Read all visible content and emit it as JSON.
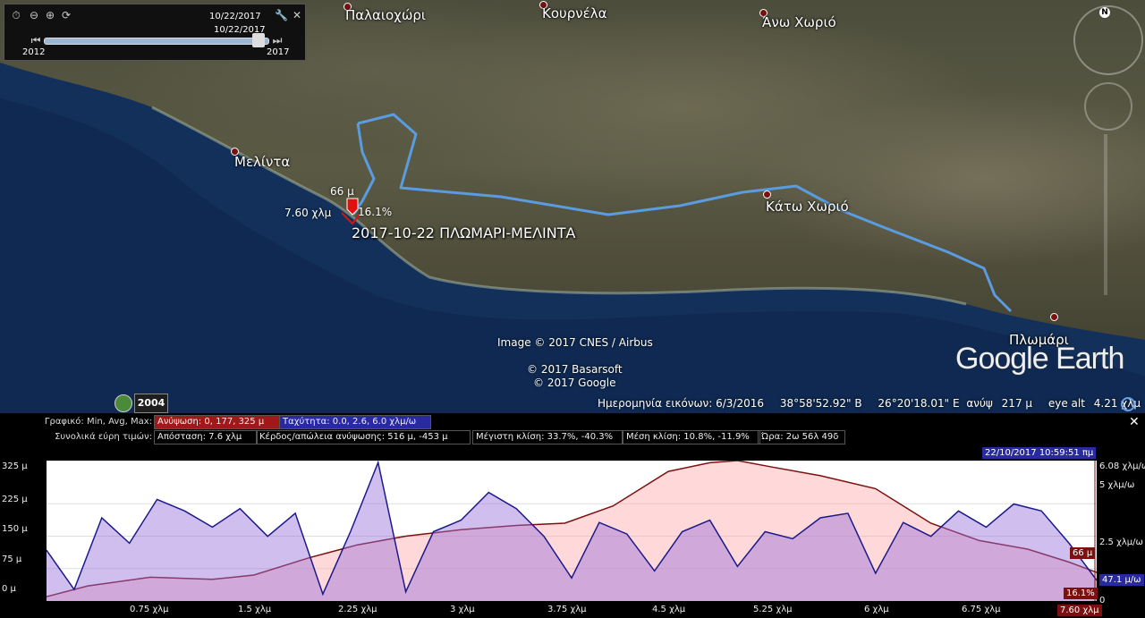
{
  "timeslider": {
    "start_date": "10/22/2017",
    "end_date": "10/22/2017",
    "year_min": "2012",
    "year_max": "2017",
    "position": 0.96
  },
  "places": [
    {
      "name": "Παλαιοχώρι"
    },
    {
      "name": "Κουρνέλα"
    },
    {
      "name": "Άνω Χωριό"
    },
    {
      "name": "Μελίντα"
    },
    {
      "name": "Κάτω Χωριό"
    },
    {
      "name": "Πλωμάρι"
    }
  ],
  "track": {
    "name": "2017-10-22 ΠΛΩΜΑΡΙ-ΜΕΛΙΝΤΑ",
    "marker_elevation": "66 μ",
    "marker_distance": "7.60 χλμ",
    "marker_slope": "16.1%",
    "color": "#5b9be0"
  },
  "credits": {
    "imagery": "Image © 2017 CNES / Airbus",
    "basarsoft": "© 2017 Basarsoft",
    "google": "© 2017 Google",
    "logo": "Google Earth"
  },
  "history": {
    "year": "2004"
  },
  "status": {
    "imagery_date": "Ημερομηνία εικόνων: 6/3/2016",
    "lat": "38°58'52.92\" Β",
    "lon": "26°20'18.01\" Ε",
    "elev_label": "ανύψ",
    "elev": "217 μ",
    "eye_alt_label": "eye alt",
    "eye_alt": "4.21 χλμ"
  },
  "profile": {
    "graph_label": "Γραφικό: Min, Avg, Max:",
    "elevation_stat": "Ανύψωση: 0, 177, 325 μ",
    "speed_stat": "Ταχύτητα: 0.0, 2.6, 6.0 χλμ/ω",
    "totals_label": "Συνολικά εύρη τιμών:",
    "distance": "Απόσταση: 7.6 χλμ",
    "gain_loss": "Κέρδος/απώλεια ανύψωσης: 516 μ, -453 μ",
    "max_slope": "Μέγιστη κλίση: 33.7%, -40.3%",
    "avg_slope": "Μέση κλίση: 10.8%, -11.9%",
    "time": "Ώρα: 2ω 56λ 49δ",
    "timestamp": "22/10/2017 10:59:51 πμ",
    "y_left_ticks": [
      "325 μ",
      "225 μ",
      "150 μ",
      "75 μ",
      "0 μ"
    ],
    "y_right_ticks": [
      "6.08 χλμ/ω",
      "5 χλμ/ω",
      "2.5 χλμ/ω",
      "0"
    ],
    "x_ticks": [
      "0.75 χλμ",
      "1.5 χλμ",
      "2.25 χλμ",
      "3 χλμ",
      "3.75 χλμ",
      "4.5 χλμ",
      "5.25 χλμ",
      "6 χλμ",
      "6.75 χλμ"
    ],
    "cursor_elev": "66 μ",
    "cursor_speed": "47.1 μ/ω",
    "cursor_slope": "16.1%",
    "cursor_dist": "7.60 χλμ",
    "elevation_color": "#7a1010",
    "speed_color": "#1a1a8a",
    "stat_elev_bg": "#9c1a1a",
    "stat_speed_bg": "#2a2aa0"
  },
  "chart_data": {
    "type": "line",
    "x_unit": "χλμ",
    "xlim": [
      0,
      7.6
    ],
    "series": [
      {
        "name": "Ανύψωση",
        "unit": "μ",
        "ylim": [
          0,
          325
        ],
        "x": [
          0,
          0.3,
          0.75,
          1.2,
          1.5,
          1.9,
          2.25,
          2.6,
          3.0,
          3.4,
          3.75,
          4.1,
          4.5,
          4.8,
          5.0,
          5.25,
          5.6,
          6.0,
          6.4,
          6.75,
          7.1,
          7.4,
          7.6
        ],
        "values": [
          10,
          35,
          55,
          50,
          60,
          100,
          130,
          150,
          165,
          175,
          180,
          220,
          300,
          320,
          325,
          310,
          290,
          260,
          180,
          140,
          120,
          90,
          66
        ]
      },
      {
        "name": "Ταχύτητα",
        "unit": "χλμ/ω",
        "ylim": [
          0,
          6.08
        ],
        "x": [
          0,
          0.2,
          0.4,
          0.6,
          0.8,
          1.0,
          1.2,
          1.4,
          1.6,
          1.8,
          2.0,
          2.2,
          2.4,
          2.6,
          2.8,
          3.0,
          3.2,
          3.4,
          3.6,
          3.8,
          4.0,
          4.2,
          4.4,
          4.6,
          4.8,
          5.0,
          5.2,
          5.4,
          5.6,
          5.8,
          6.0,
          6.2,
          6.4,
          6.6,
          6.8,
          7.0,
          7.2,
          7.4,
          7.6
        ],
        "values": [
          2.2,
          0.5,
          3.6,
          2.5,
          4.4,
          3.9,
          3.2,
          4.0,
          2.8,
          3.8,
          0.3,
          3.0,
          6.0,
          0.4,
          3.0,
          3.5,
          4.7,
          4.0,
          2.8,
          1.0,
          3.4,
          2.9,
          1.3,
          3.0,
          3.5,
          1.5,
          3.0,
          2.7,
          3.6,
          3.8,
          1.2,
          3.4,
          2.8,
          3.9,
          3.2,
          4.2,
          3.9,
          2.5,
          0.9
        ]
      }
    ]
  }
}
